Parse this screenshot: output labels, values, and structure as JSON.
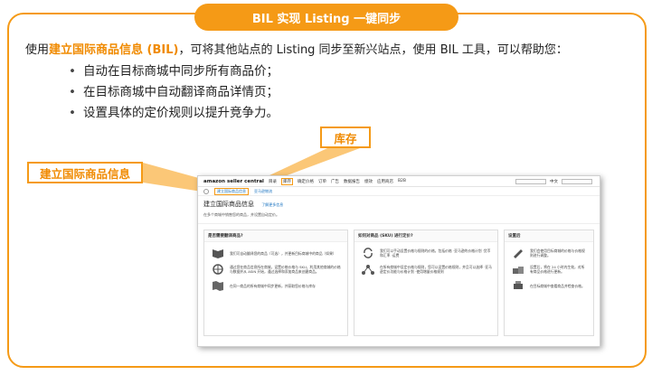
{
  "title": "BIL 实现 Listing 一键同步",
  "intro": {
    "prefix": "使用",
    "highlight": "建立国际商品信息 (BIL)",
    "suffix": "，可将其他站点的 Listing 同步至新兴站点，使用 BIL 工具，可以帮助您："
  },
  "bullets": [
    "自动在目标商城中同步所有商品价；",
    "在目标商城中自动翻译商品详情页；",
    "设置具体的定价规则以提升竞争力。"
  ],
  "callouts": {
    "intl": "建立国际商品信息",
    "stock": "库存"
  },
  "screenshot": {
    "logo": "amazon seller central",
    "nav": [
      "目录",
      "库存",
      "确定价格",
      "订单",
      "广告",
      "数据报告",
      "绩效",
      "应用商店",
      "B2B"
    ],
    "active_nav": "库存",
    "sub_selected": "建立国际商品信息",
    "sub_other": "亚马逊物流",
    "page_title": "建立国际商品信息",
    "page_link": "了解更多信息",
    "page_desc": "在多个商城中销售您的商品，并设置自动定价。",
    "cards": [
      {
        "title": "是否需要翻译商品?",
        "rows": [
          "我们可自动翻译您的商品（可选），并更新目标商城中的商品（如果）",
          "通过您在商品信息所在商城，设置价格价格与 SKU，利用其他商城的价格与数据并从 ASIN 开始，通过选择和添加商品来创建商品。",
          "在同一商品的所有商城中同步更新，并获取您价格与库存"
        ]
      },
      {
        "title": "如何对商品 (SKU) 进行定价?",
        "rows": [
          "我们可以手动设置价格与规则的价格，包括价格\n·亚马逊的价格计划\n·货币和汇率\n·运费",
          "在所有商城中设定价格与规则，您可以设置价格规则，并且可以选择\n·亚马逊定价功能与价格计划\n·使用增量价格规则"
        ]
      },
      {
        "title": "设置后",
        "rows": [
          "我们会使用目标商城的价格与价格规则进行调整。",
          "设置后，将在 24 小时内生效，对所有商品价格进行更新。",
          "在目标商城中查看商品并检查价格。"
        ]
      }
    ],
    "language": "中文",
    "search_hint": "搜索"
  }
}
